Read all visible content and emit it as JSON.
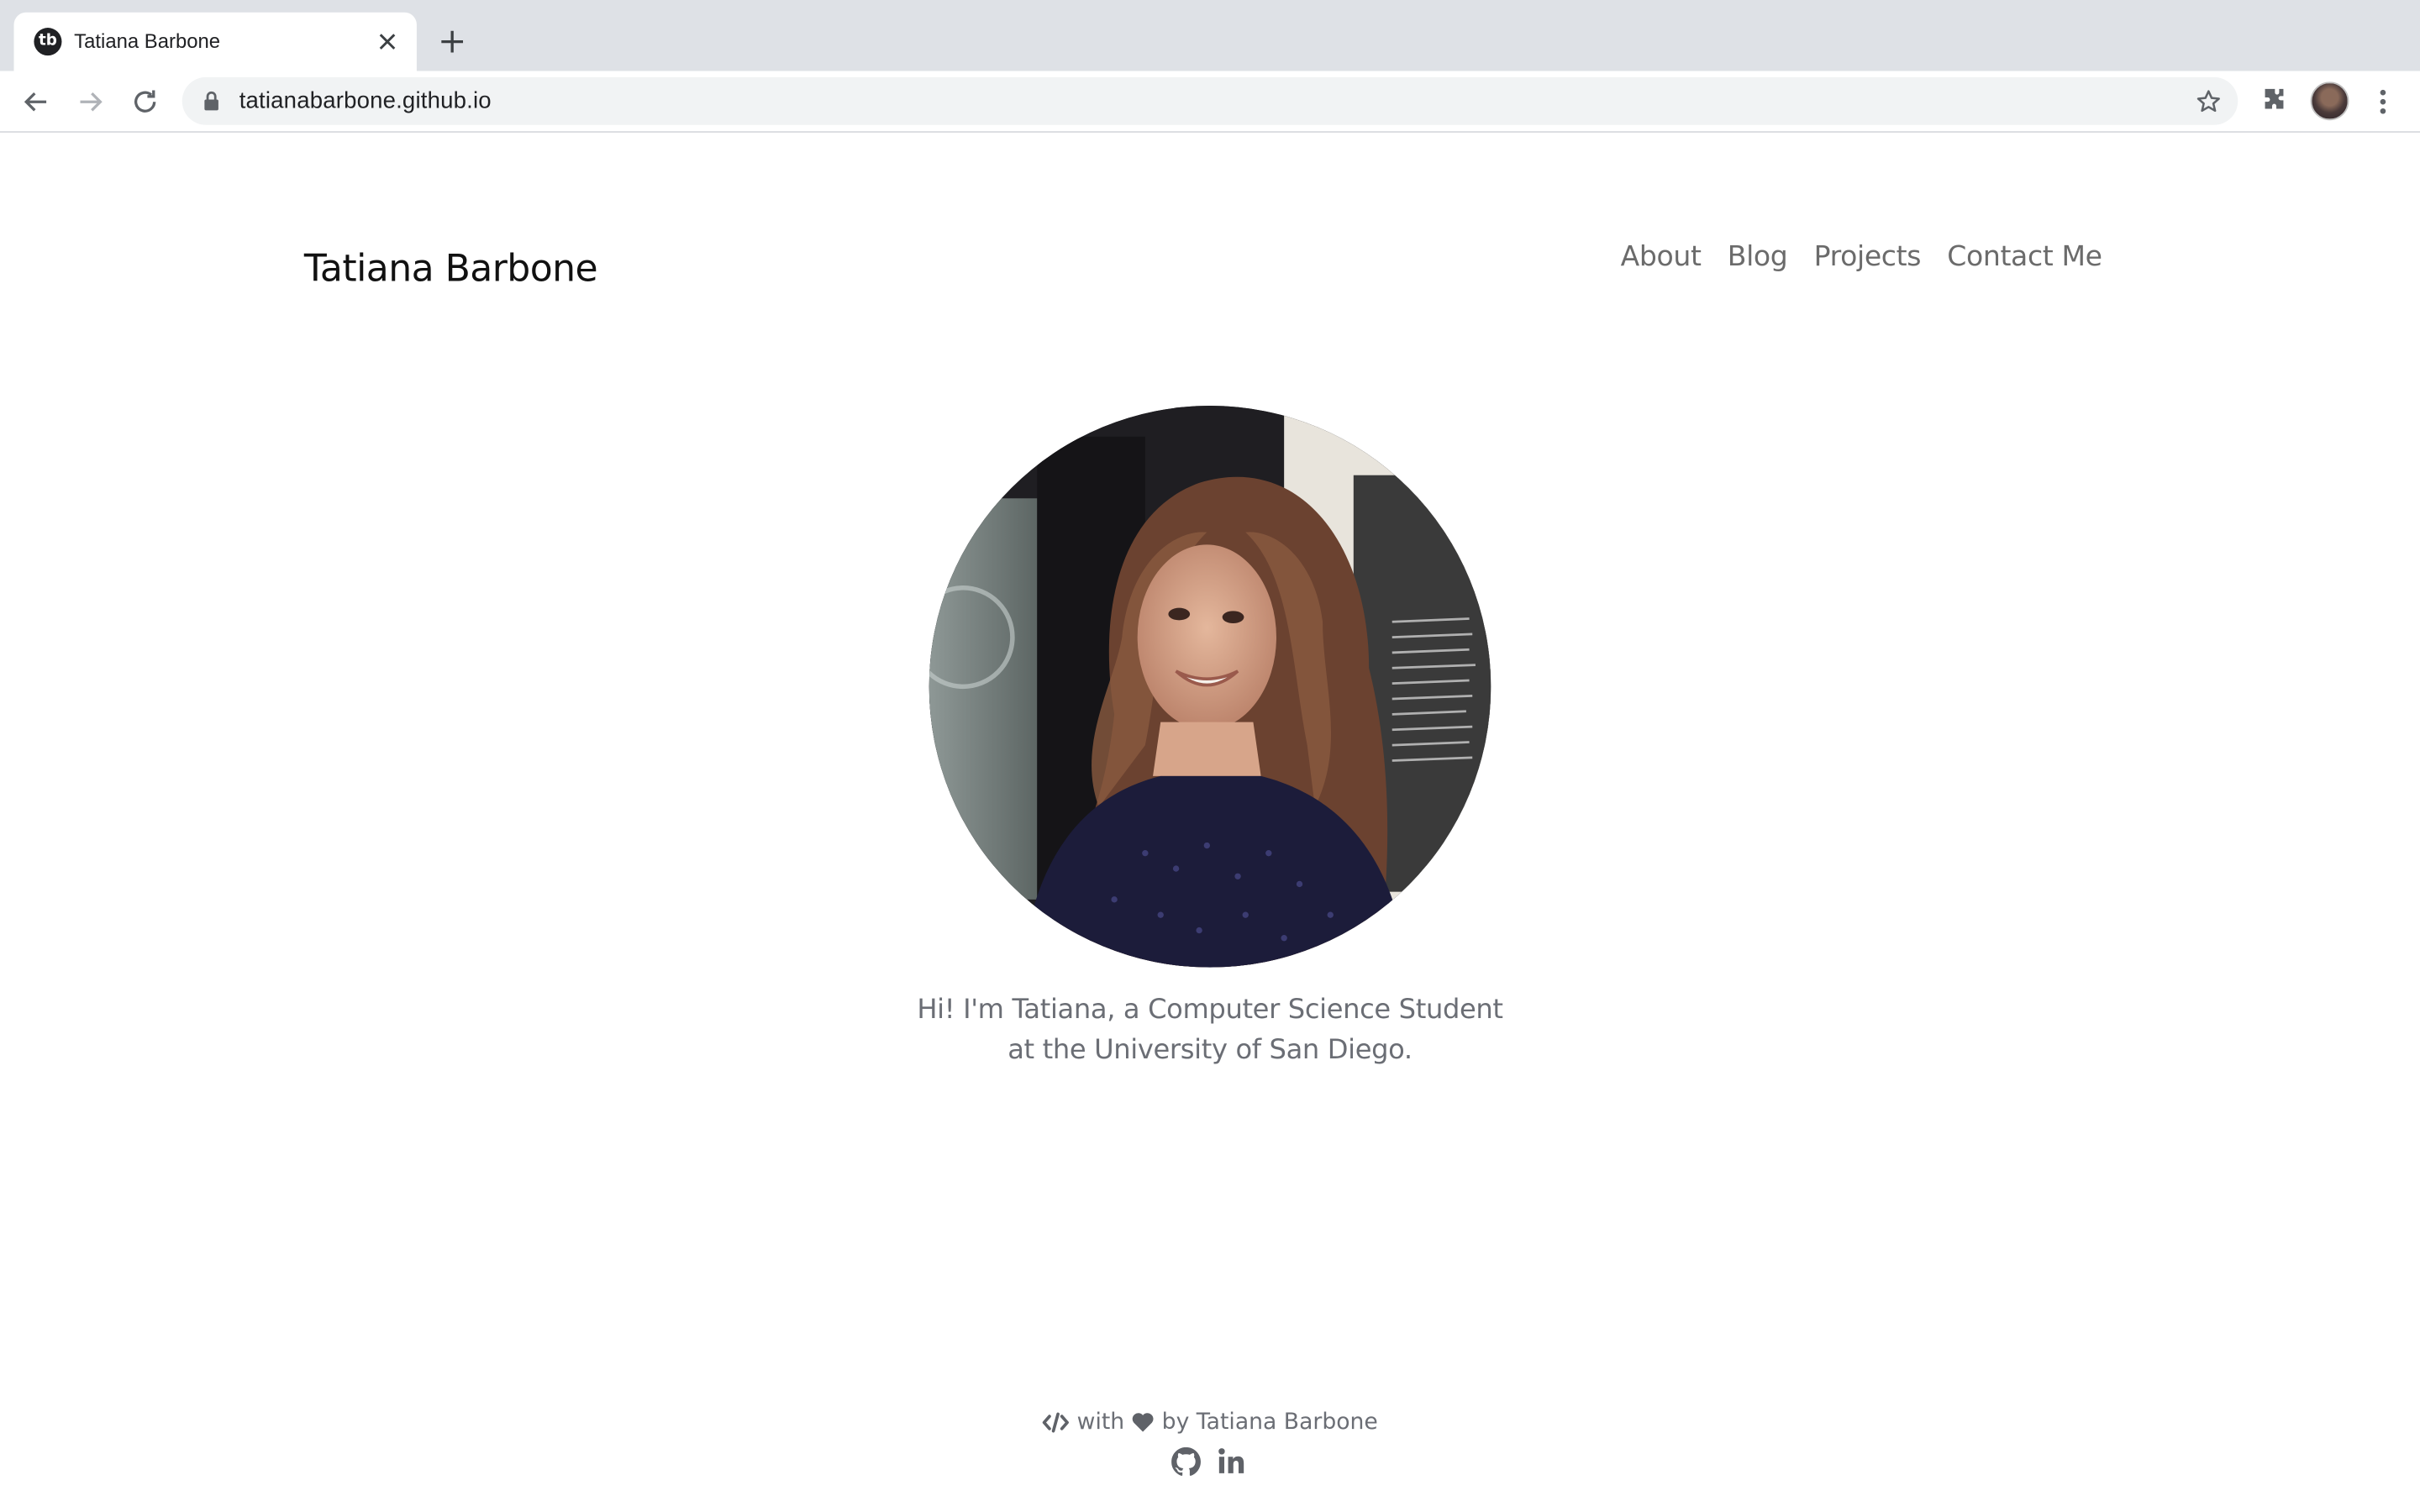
{
  "browser": {
    "tab_title": "Tatiana Barbone",
    "favicon_text": "tb",
    "url": "tatianabarbone.github.io"
  },
  "site": {
    "title": "Tatiana Barbone",
    "nav": [
      "About",
      "Blog",
      "Projects",
      "Contact Me"
    ],
    "intro": "Hi! I'm Tatiana, a Computer Science Student at the University of San Diego.",
    "footer": {
      "with": "with",
      "by": "by Tatiana Barbone",
      "icons": [
        "code-icon",
        "heart-icon",
        "github-icon",
        "linkedin-icon"
      ]
    }
  },
  "colors": {
    "chrome_tabstrip": "#dee1e6",
    "omnibox": "#f1f3f4",
    "nav_text": "#6b6b6b",
    "body_text": "#6b6e75"
  }
}
